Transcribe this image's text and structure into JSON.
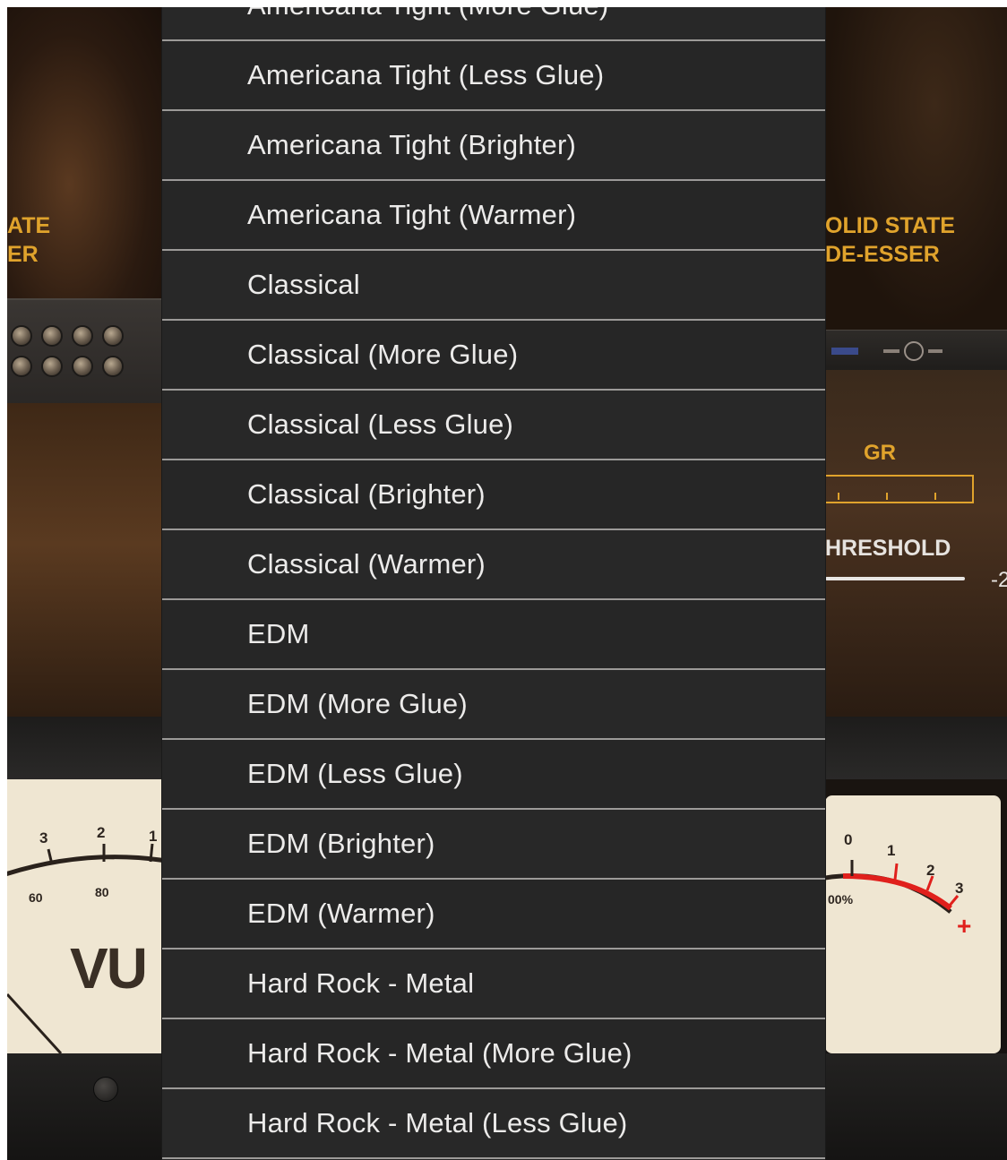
{
  "menu": {
    "items": [
      "Americana Tight (More Glue)",
      "Americana Tight (Less Glue)",
      "Americana Tight (Brighter)",
      "Americana Tight (Warmer)",
      "Classical",
      "Classical (More Glue)",
      "Classical (Less Glue)",
      "Classical (Brighter)",
      "Classical (Warmer)",
      "EDM",
      "EDM (More Glue)",
      "EDM (Less Glue)",
      "EDM (Brighter)",
      "EDM (Warmer)",
      "Hard Rock - Metal",
      "Hard Rock - Metal (More Glue)",
      "Hard Rock - Metal (Less Glue)"
    ]
  },
  "left_module": {
    "label_line1": "ATE",
    "label_line2": "ER"
  },
  "right_module": {
    "label_line1": "OLID STATE",
    "label_line2": "DE-ESSER",
    "gr_label": "GR",
    "threshold_label": "HRESHOLD",
    "threshold_value": "-2"
  },
  "vu_left": {
    "title": "VU",
    "scale": [
      "3",
      "2",
      "1"
    ],
    "percent": [
      "60",
      "80"
    ]
  },
  "vu_right": {
    "scale": [
      "0",
      "1",
      "2",
      "3"
    ],
    "percent": "00%",
    "plus": "+"
  },
  "colors": {
    "accent": "#e0a32c",
    "menu_bg": "#262626",
    "menu_text": "#ecebea",
    "separator": "#9c9a98",
    "vu_face": "#efe6d2",
    "vu_red": "#e0201c"
  }
}
